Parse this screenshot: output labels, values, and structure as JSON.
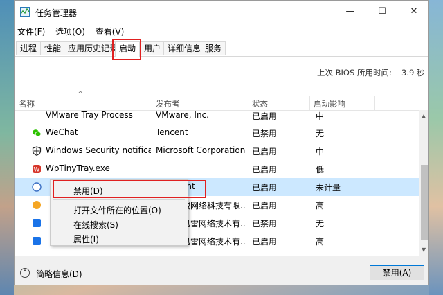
{
  "window": {
    "title": "任务管理器",
    "minimize_glyph": "—",
    "maximize_glyph": "☐",
    "close_glyph": "✕"
  },
  "menu": [
    "文件(F)",
    "选项(O)",
    "查看(V)"
  ],
  "tabs": [
    "进程",
    "性能",
    "应用历史记录",
    "启动",
    "用户",
    "详细信息",
    "服务"
  ],
  "active_tab": "启动",
  "bios": {
    "label": "上次 BIOS 所用时间:",
    "value": "3.9 秒"
  },
  "columns": [
    "名称",
    "发布者",
    "状态",
    "启动影响"
  ],
  "rows": [
    {
      "name": "VMware Tray Process",
      "publisher": "VMware, Inc.",
      "status": "已启用",
      "impact": "中",
      "icon": "vmware-icon"
    },
    {
      "name": "WeChat",
      "publisher": "Tencent",
      "status": "已禁用",
      "impact": "无",
      "icon": "wechat-icon"
    },
    {
      "name": "Windows Security notifica...",
      "publisher": "Microsoft Corporation",
      "status": "已启用",
      "impact": "中",
      "icon": "shield-icon"
    },
    {
      "name": "WpTinyTray.exe",
      "publisher": "",
      "status": "已启用",
      "impact": "低",
      "icon": "wps-icon"
    },
    {
      "name": "",
      "publisher": "ent",
      "status": "已启用",
      "impact": "未计量",
      "icon": "app-icon"
    },
    {
      "name": "",
      "publisher": "火绒网络科技有限...",
      "status": "已启用",
      "impact": "高",
      "icon": "huorong-icon"
    },
    {
      "name": "",
      "publisher": "市迅雷网络技术有...",
      "status": "已禁用",
      "impact": "无",
      "icon": "xunlei-icon"
    },
    {
      "name": "",
      "publisher": "市迅雷网络技术有...",
      "status": "已启用",
      "impact": "高",
      "icon": "xunlei-icon"
    }
  ],
  "context_menu": [
    "禁用(D)",
    "打开文件所在的位置(O)",
    "在线搜索(S)",
    "属性(I)"
  ],
  "footer": {
    "fewer_details": "简略信息(D)",
    "disable_button": "禁用(A)"
  },
  "colors": {
    "highlight_red": "#e02020",
    "selection": "#cce8ff",
    "accent": "#0078d7"
  }
}
